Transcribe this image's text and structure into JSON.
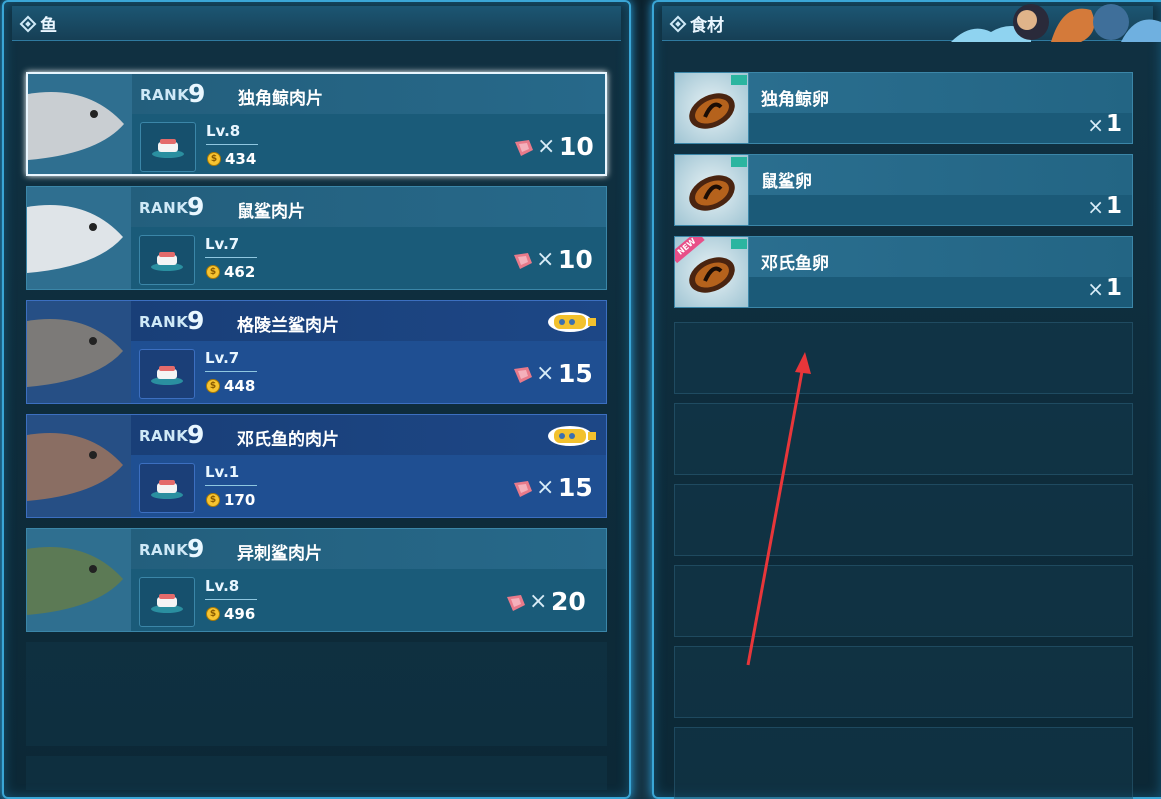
{
  "fish_panel": {
    "title": "鱼",
    "items": [
      {
        "rank_label": "RANK",
        "rank": "9",
        "name": "独角鲸肉片",
        "level": "Lv.8",
        "price": "434",
        "qty_x": "×",
        "qty": "10",
        "selected": true,
        "style": "normal",
        "sub_badge": false
      },
      {
        "rank_label": "RANK",
        "rank": "9",
        "name": "鼠鲨肉片",
        "level": "Lv.7",
        "price": "462",
        "qty_x": "×",
        "qty": "10",
        "selected": false,
        "style": "normal",
        "sub_badge": false
      },
      {
        "rank_label": "RANK",
        "rank": "9",
        "name": "格陵兰鲨肉片",
        "level": "Lv.7",
        "price": "448",
        "qty_x": "×",
        "qty": "15",
        "selected": false,
        "style": "alt",
        "sub_badge": true
      },
      {
        "rank_label": "RANK",
        "rank": "9",
        "name": "邓氏鱼的肉片",
        "level": "Lv.1",
        "price": "170",
        "qty_x": "×",
        "qty": "15",
        "selected": false,
        "style": "alt",
        "sub_badge": true
      },
      {
        "rank_label": "RANK",
        "rank": "9",
        "name": "异刺鲨肉片",
        "level": "Lv.8",
        "price": "496",
        "qty_x": "×",
        "qty": "20",
        "selected": false,
        "style": "normal",
        "sub_badge": false
      }
    ]
  },
  "ingredient_panel": {
    "title": "食材",
    "items": [
      {
        "name": "独角鲸卵",
        "qty_x": "×",
        "qty": "1",
        "new": false
      },
      {
        "name": "鼠鲨卵",
        "qty_x": "×",
        "qty": "1",
        "new": false
      },
      {
        "name": "邓氏鱼卵",
        "qty_x": "×",
        "qty": "1",
        "new": true,
        "new_label": "NEW"
      }
    ]
  },
  "colors": {
    "panel_border": "#3aa6d6",
    "card_normal": "#1a5b79",
    "card_alt": "#1f4f92",
    "arrow": "#e8363a",
    "coin": "#f7c431",
    "meat": "#e87a8a"
  },
  "icons": {
    "header": "diamond-icon",
    "coin": "coin-icon",
    "meat": "meat-slice-icon",
    "sushi": "sushi-plate-icon",
    "submarine": "submarine-icon",
    "egg": "fish-roe-icon"
  }
}
